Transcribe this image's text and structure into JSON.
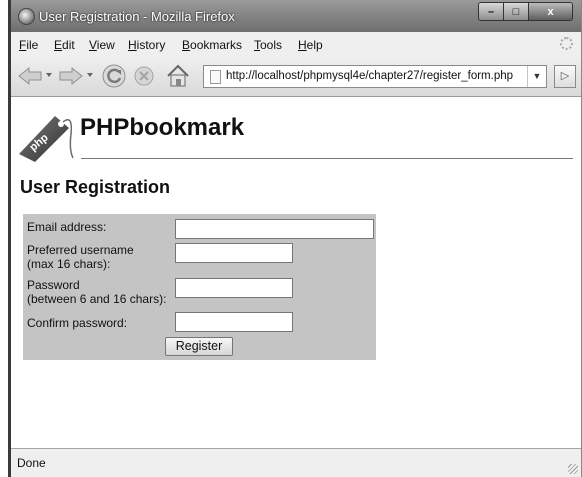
{
  "window": {
    "title": "User Registration - Mozilla Firefox",
    "app_icon": "firefox-icon",
    "controls": {
      "minimize": "–",
      "maximize": "□",
      "close": "x"
    }
  },
  "menubar": {
    "items": [
      "File",
      "Edit",
      "View",
      "History",
      "Bookmarks",
      "Tools",
      "Help"
    ]
  },
  "navbar": {
    "icons": [
      "back-arrow-icon",
      "forward-arrow-icon",
      "reload-icon",
      "stop-icon",
      "home-icon"
    ],
    "url": "http://localhost/phpmysql4e/chapter27/register_form.php",
    "url_dropdown": "▼",
    "go_glyph": "▷"
  },
  "page": {
    "site_title": "PHPbookmark",
    "logo_text": "php",
    "heading": "User Registration",
    "form": {
      "fields": [
        {
          "label": "Email address:",
          "value": "",
          "type": "text"
        },
        {
          "label": "Preferred username\n(max 16 chars):",
          "value": "",
          "type": "text"
        },
        {
          "label": "Password\n(between 6 and 16 chars):",
          "value": "",
          "type": "password"
        },
        {
          "label": "Confirm password:",
          "value": "",
          "type": "password"
        }
      ],
      "submit_label": "Register"
    }
  },
  "statusbar": {
    "text": "Done"
  },
  "colors": {
    "form_background": "#c4c4c4",
    "titlebar": "#7a7a7a",
    "chrome": "#ececec"
  }
}
